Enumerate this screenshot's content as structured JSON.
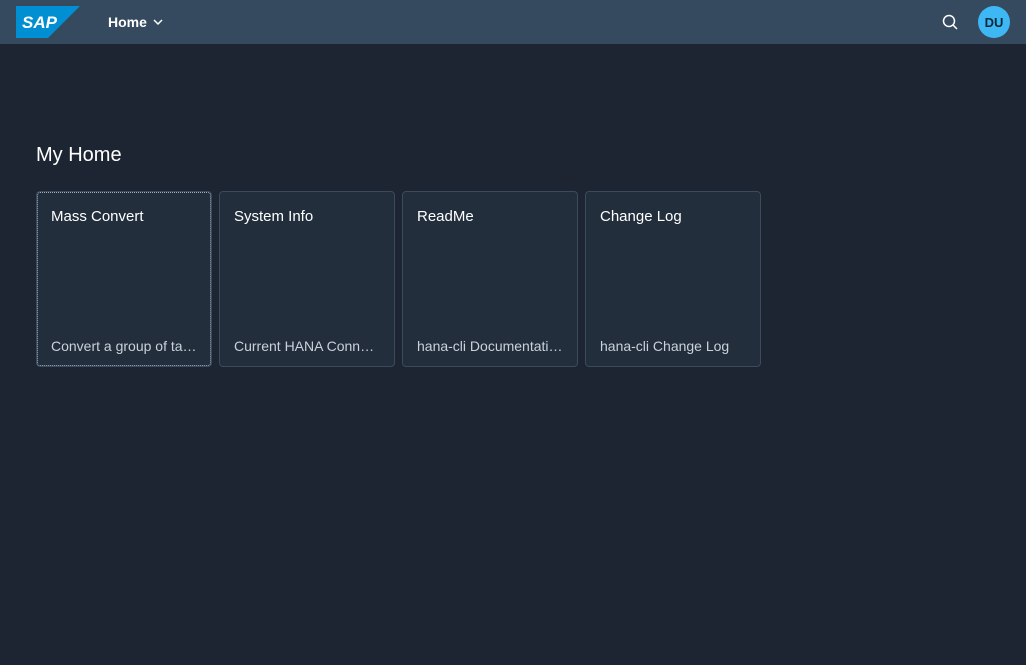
{
  "shellbar": {
    "logo_text": "SAP",
    "nav_label": "Home",
    "avatar_initials": "DU"
  },
  "section_title": "My Home",
  "tiles": [
    {
      "title": "Mass Convert",
      "desc": "Convert a group of tables",
      "focused": true
    },
    {
      "title": "System Info",
      "desc": "Current HANA Connection",
      "focused": false
    },
    {
      "title": "ReadMe",
      "desc": "hana-cli Documentation",
      "focused": false
    },
    {
      "title": "Change Log",
      "desc": "hana-cli Change Log",
      "focused": false
    }
  ]
}
